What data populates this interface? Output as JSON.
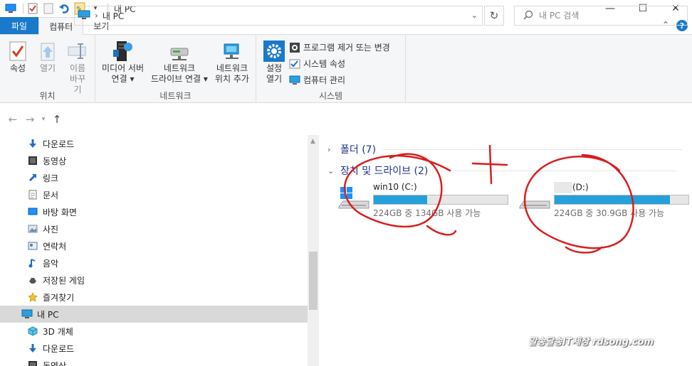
{
  "window": {
    "title": "내 PC",
    "minimize": "—",
    "maximize": "☐",
    "close": "✕"
  },
  "tabs": [
    {
      "label": "파일"
    },
    {
      "label": "컴퓨터"
    },
    {
      "label": "보기"
    }
  ],
  "ribbon": {
    "location": {
      "label": "위치",
      "properties": "속성",
      "open": "열기",
      "rename": "이름\n바꾸기"
    },
    "network": {
      "label": "네트워크",
      "media_server": "미디어 서버\n연결 ▾",
      "map_drive": "네트워크\n드라이브 연결 ▾",
      "add_location": "네트워크\n위치 추가"
    },
    "system": {
      "label": "시스템",
      "settings": "설정\n열기",
      "uninstall": "프로그램 제거 또는 변경",
      "system_props": "시스템 속성",
      "manage": "컴퓨터 관리"
    }
  },
  "address": {
    "path": "내 PC",
    "separator": "›",
    "search_placeholder": "내 PC 검색"
  },
  "nav": [
    {
      "label": "다운로드",
      "icon": "download-icon"
    },
    {
      "label": "동영상",
      "icon": "video-icon"
    },
    {
      "label": "링크",
      "icon": "link-icon"
    },
    {
      "label": "문서",
      "icon": "document-icon"
    },
    {
      "label": "바탕 화면",
      "icon": "desktop-icon"
    },
    {
      "label": "사진",
      "icon": "picture-icon"
    },
    {
      "label": "연락처",
      "icon": "contacts-icon"
    },
    {
      "label": "음악",
      "icon": "music-icon"
    },
    {
      "label": "저장된 게임",
      "icon": "saved-games-icon"
    },
    {
      "label": "즐겨찾기",
      "icon": "favorites-icon"
    },
    {
      "label": "내 PC",
      "icon": "pc-icon"
    },
    {
      "label": "3D 개체",
      "icon": "3d-objects-icon"
    },
    {
      "label": "다운로드",
      "icon": "download-icon"
    },
    {
      "label": "동영상",
      "icon": "video-icon"
    }
  ],
  "content": {
    "folders_header": "폴더 (7)",
    "drives_header": "장치 및 드라이브 (2)",
    "drives": [
      {
        "name": "win10 (C:)",
        "size": "224GB 중 134GB 사용 가능",
        "used_fraction": 0.4
      },
      {
        "name": "(D:)",
        "size": "224GB 중 30.9GB 사용 가능",
        "used_fraction": 0.86
      }
    ]
  },
  "watermark": "알송달송IT세상 rdsong.com",
  "colors": {
    "accent": "#1979ca",
    "drive_bar": "#26a0da",
    "annotation": "#d81e1e"
  }
}
